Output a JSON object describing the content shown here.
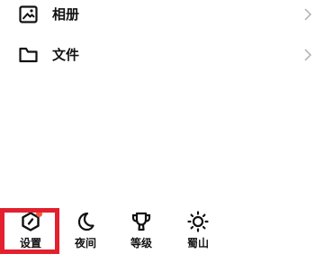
{
  "menu": {
    "items": [
      {
        "label": "相册",
        "icon": "photo-album-icon",
        "trailing_icon": "chevron-right-icon"
      },
      {
        "label": "文件",
        "icon": "folder-icon",
        "trailing_icon": "chevron-right-icon"
      }
    ]
  },
  "bottom_bar": {
    "items": [
      {
        "label": "设置",
        "icon": "settings-hexagon-icon",
        "has_badge": true,
        "badge_color": "#f05a3c",
        "highlighted": true
      },
      {
        "label": "夜间",
        "icon": "moon-icon"
      },
      {
        "label": "等级",
        "icon": "trophy-icon"
      },
      {
        "label": "蜀山",
        "icon": "sun-icon"
      }
    ]
  },
  "colors": {
    "text": "#111111",
    "chevron": "#b0b0b0",
    "highlight_border": "#e3202e",
    "background": "#ffffff"
  }
}
